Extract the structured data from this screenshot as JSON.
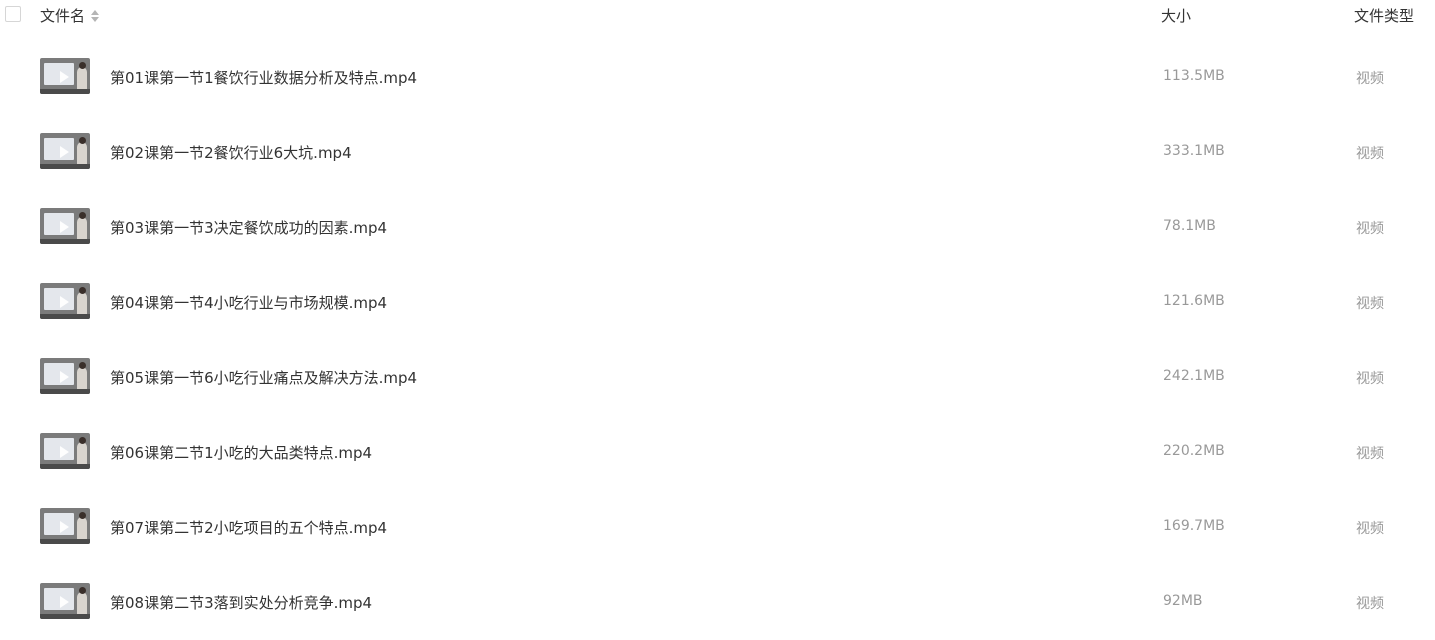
{
  "header": {
    "name_label": "文件名",
    "size_label": "大小",
    "type_label": "文件类型",
    "sort_icon": "sort-icon"
  },
  "files": [
    {
      "name": "第01课第一节1餐饮行业数据分析及特点.mp4",
      "size": "113.5MB",
      "type": "视频"
    },
    {
      "name": "第02课第一节2餐饮行业6大坑.mp4",
      "size": "333.1MB",
      "type": "视频"
    },
    {
      "name": "第03课第一节3决定餐饮成功的因素.mp4",
      "size": "78.1MB",
      "type": "视频"
    },
    {
      "name": "第04课第一节4小吃行业与市场规模.mp4",
      "size": "121.6MB",
      "type": "视频"
    },
    {
      "name": "第05课第一节6小吃行业痛点及解决方法.mp4",
      "size": "242.1MB",
      "type": "视频"
    },
    {
      "name": "第06课第二节1小吃的大品类特点.mp4",
      "size": "220.2MB",
      "type": "视频"
    },
    {
      "name": "第07课第二节2小吃项目的五个特点.mp4",
      "size": "169.7MB",
      "type": "视频"
    },
    {
      "name": "第08课第二节3落到实处分析竞争.mp4",
      "size": "92MB",
      "type": "视频"
    }
  ]
}
